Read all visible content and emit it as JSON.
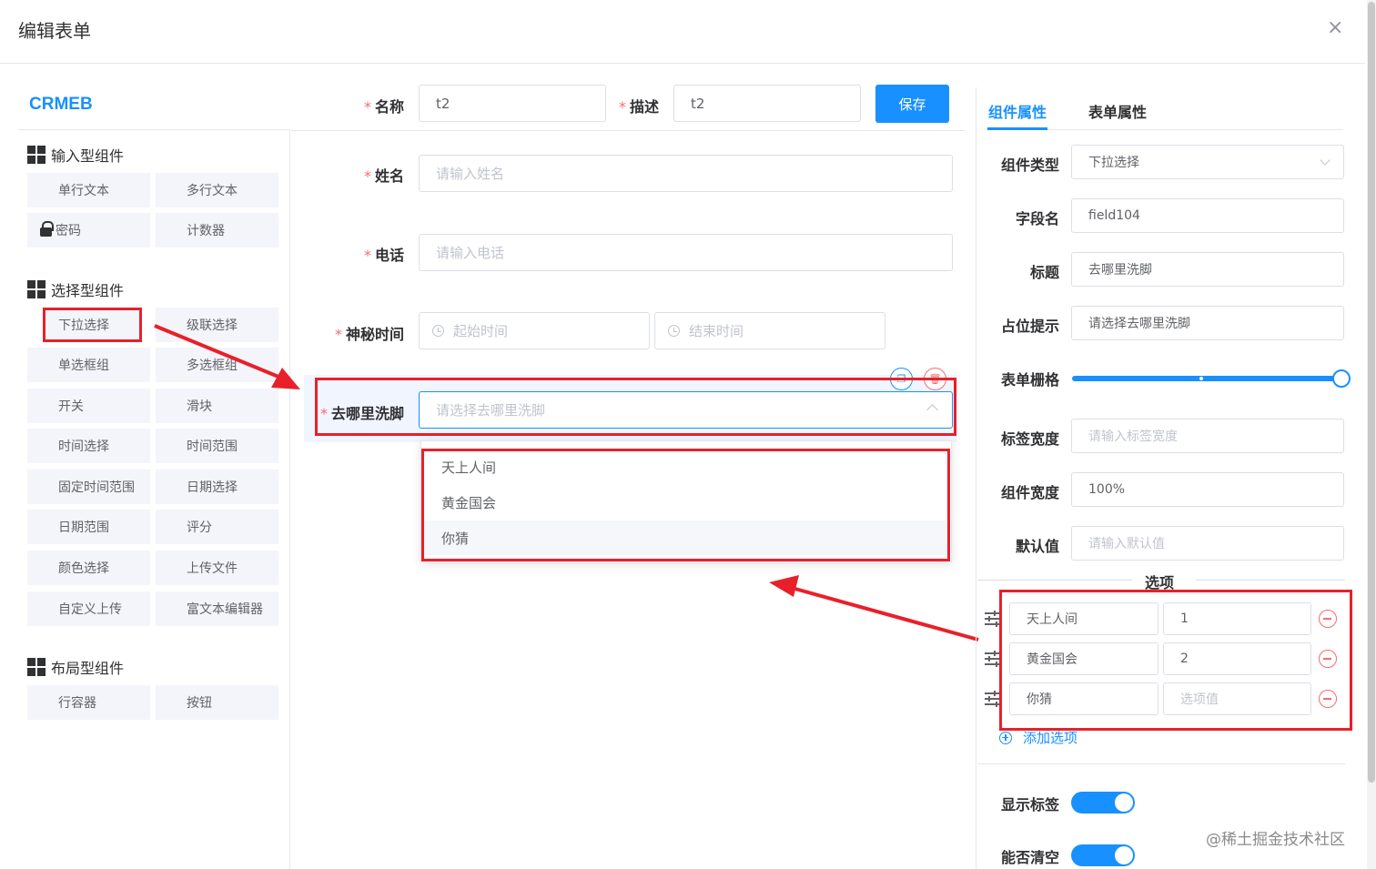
{
  "dialog": {
    "title": "编辑表单",
    "close": "×"
  },
  "brand": "CRMEB",
  "groups": {
    "input": {
      "title": "输入型组件",
      "items": [
        "单行文本",
        "多行文本",
        "密码",
        "计数器"
      ]
    },
    "select": {
      "title": "选择型组件",
      "items": [
        "下拉选择",
        "级联选择",
        "单选框组",
        "多选框组",
        "开关",
        "滑块",
        "时间选择",
        "时间范围",
        "固定时间范围",
        "日期选择",
        "日期范围",
        "评分",
        "颜色选择",
        "上传文件",
        "自定义上传",
        "富文本编辑器"
      ]
    },
    "layout": {
      "title": "布局型组件",
      "items": [
        "行容器",
        "按钮"
      ]
    }
  },
  "form_meta": {
    "name_label": "名称",
    "name_value": "t2",
    "desc_label": "描述",
    "desc_value": "t2",
    "save": "保存"
  },
  "fields": {
    "name": {
      "label": "姓名",
      "placeholder": "请输入姓名"
    },
    "phone": {
      "label": "电话",
      "placeholder": "请输入电话"
    },
    "time": {
      "label": "神秘时间",
      "start": "起始时间",
      "end": "结束时间"
    },
    "dest": {
      "label": "去哪里洗脚",
      "placeholder": "请选择去哪里洗脚"
    }
  },
  "dropdown_options": [
    "天上人间",
    "黄金国会",
    "你猜"
  ],
  "right": {
    "tabs": [
      "组件属性",
      "表单属性"
    ],
    "props": {
      "type_label": "组件类型",
      "type_value": "下拉选择",
      "field_label": "字段名",
      "field_value": "field104",
      "title_label": "标题",
      "title_value": "去哪里洗脚",
      "ph_label": "占位提示",
      "ph_value": "请选择去哪里洗脚",
      "grid_label": "表单栅格",
      "lw_label": "标签宽度",
      "lw_placeholder": "请输入标签宽度",
      "cw_label": "组件宽度",
      "cw_value": "100%",
      "def_label": "默认值",
      "def_placeholder": "请输入默认值"
    },
    "options_title": "选项",
    "options": [
      {
        "label": "天上人间",
        "value": "1"
      },
      {
        "label": "黄金国会",
        "value": "2"
      },
      {
        "label": "你猜",
        "value": "",
        "value_placeholder": "选项值"
      }
    ],
    "add_option": "添加选项",
    "show_label": "显示标签",
    "clearable": "能否清空"
  },
  "watermark": "@稀土掘金技术社区",
  "colors": {
    "primary": "#1890ff",
    "annotation_red": "#e8202a"
  }
}
